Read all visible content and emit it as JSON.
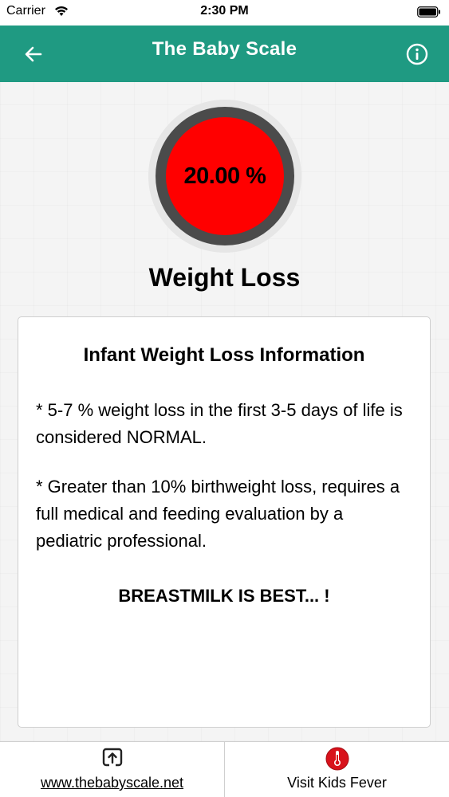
{
  "status_bar": {
    "carrier": "Carrier",
    "time": "2:30 PM"
  },
  "nav": {
    "title": "The Baby Scale",
    "back_icon": "arrow-left-icon",
    "info_icon": "info-icon"
  },
  "colors": {
    "nav_bg": "#1f9a82",
    "gauge_fill": "#ff0000",
    "gauge_ring": "#4b4b4b"
  },
  "gauge": {
    "value": "20.00 %"
  },
  "section_title": "Weight Loss",
  "info_card": {
    "heading": "Infant Weight Loss Information",
    "paragraphs": [
      "* 5-7 % weight loss in the first 3-5 days of life is considered NORMAL.",
      "* Greater than 10% birthweight loss, requires a full medical and feeding evaluation by a pediatric professional."
    ],
    "slogan": "BREASTMILK IS BEST... !"
  },
  "bottom_bar": {
    "left": {
      "label": "www.thebabyscale.net",
      "icon": "share-link-icon"
    },
    "right": {
      "label": "Visit Kids Fever",
      "icon": "thermometer-icon"
    }
  }
}
